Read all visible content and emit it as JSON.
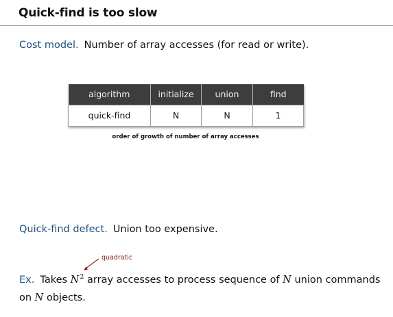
{
  "slide": {
    "title": "Quick-find is too slow"
  },
  "cost_model": {
    "lead": "Cost model.",
    "text": "Number of array accesses (for read or write)."
  },
  "table": {
    "headers": [
      "algorithm",
      "initialize",
      "union",
      "find"
    ],
    "rows": [
      [
        "quick-find",
        "N",
        "N",
        "1"
      ]
    ],
    "caption": "order of growth of number of array accesses",
    "header_color": "#3d3d3d"
  },
  "defect": {
    "lead": "Quick-find defect.",
    "text": "Union too expensive."
  },
  "annotation": {
    "text": "quadratic",
    "color": "#8b1a1a"
  },
  "example": {
    "lead": "Ex.",
    "part1": "Takes",
    "var_n": "N",
    "exponent": "2",
    "part2": "array accesses to process sequence of",
    "var_n2": "N",
    "part3": "union commands",
    "part4": "on",
    "var_n3": "N",
    "part5": "objects."
  },
  "colors": {
    "lead_text": "#1f4f8a",
    "title_rule": "#9a9a9a"
  }
}
